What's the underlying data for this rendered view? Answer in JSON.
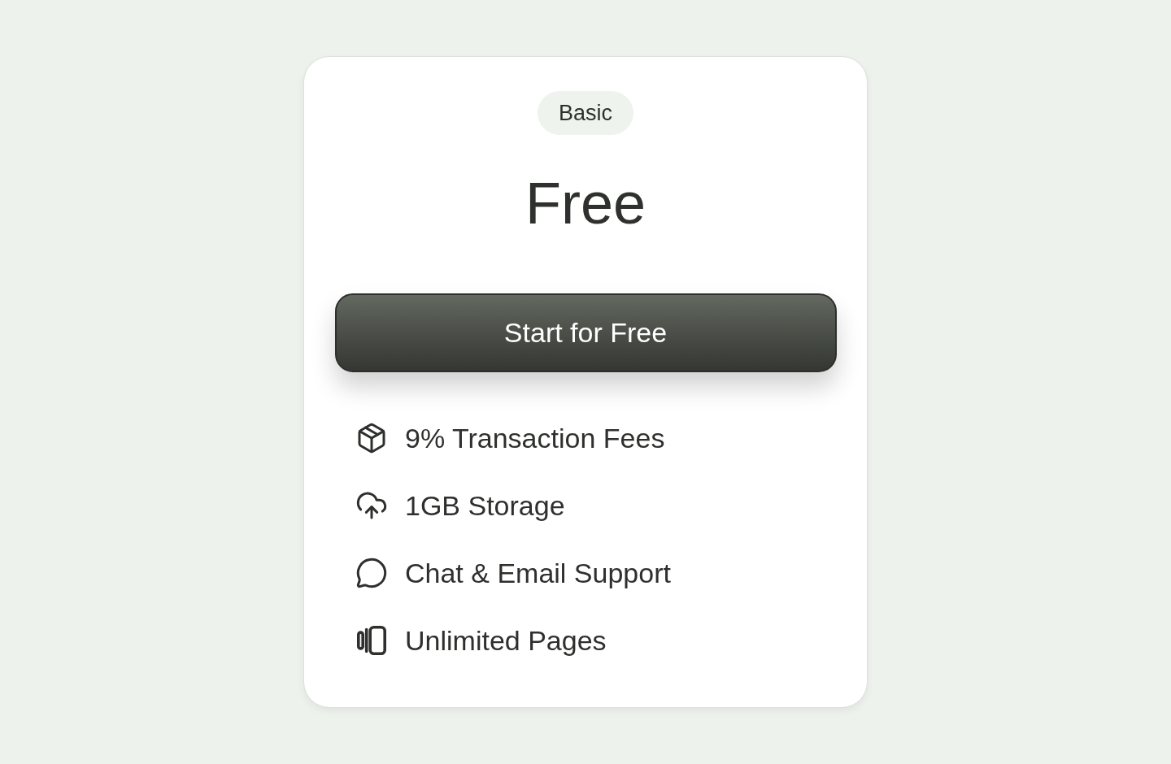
{
  "plan": {
    "badge": "Basic",
    "price": "Free",
    "cta": {
      "label": "Start for Free"
    },
    "features": [
      {
        "text": "9% Transaction Fees"
      },
      {
        "text": "1GB Storage"
      },
      {
        "text": "Chat & Email Support"
      },
      {
        "text": "Unlimited Pages"
      }
    ]
  }
}
